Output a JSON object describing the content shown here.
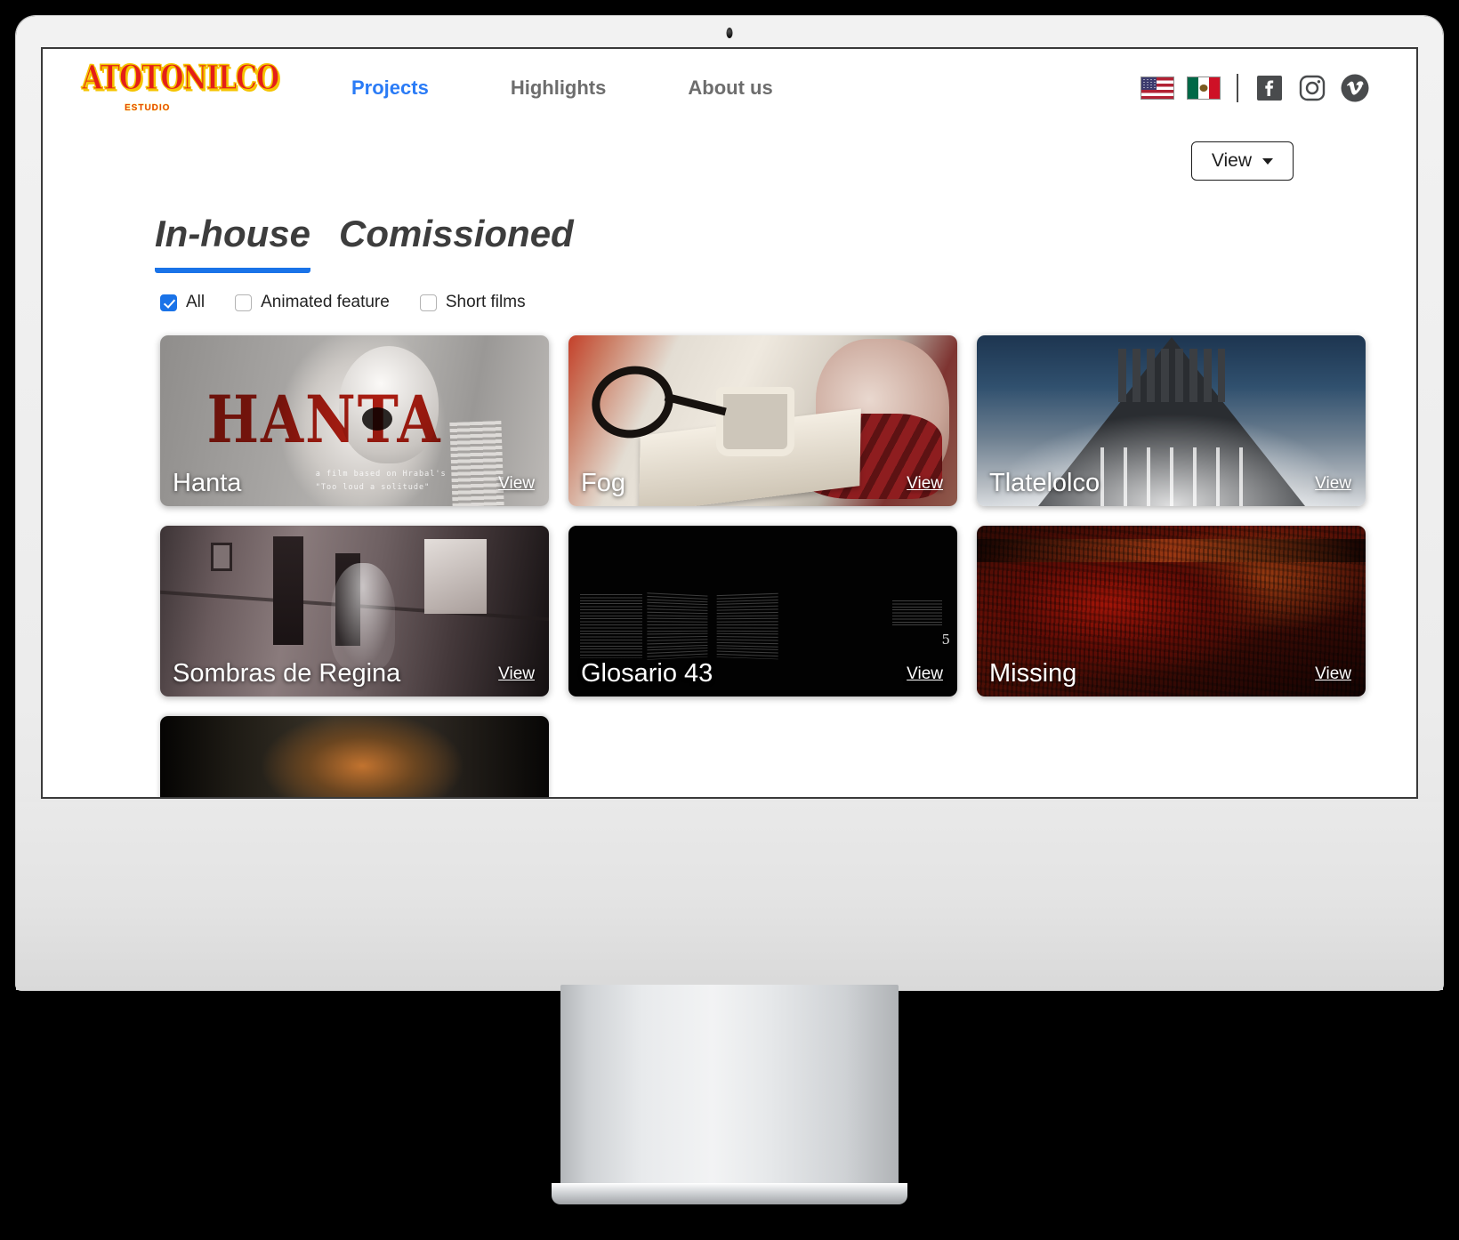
{
  "brand": {
    "logo_text": "ATOTONILCO",
    "logo_sub": "ESTUDIO",
    "accent_red": "#e41f18",
    "accent_yellow": "#f5c400"
  },
  "nav": {
    "items": [
      {
        "label": "Projects",
        "active": true
      },
      {
        "label": "Highlights",
        "active": false
      },
      {
        "label": "About us",
        "active": false
      }
    ],
    "active_color": "#2a7bf6",
    "inactive_color": "#6d6d6d"
  },
  "header_right": {
    "flags": [
      {
        "name": "flag-us-icon",
        "label": "United States"
      },
      {
        "name": "flag-mx-icon",
        "label": "Mexico"
      }
    ],
    "social": [
      {
        "name": "facebook-icon",
        "label": "Facebook"
      },
      {
        "name": "instagram-icon",
        "label": "Instagram"
      },
      {
        "name": "vimeo-icon",
        "label": "Vimeo"
      }
    ]
  },
  "toolbar": {
    "view_label": "View",
    "caret_icon": "chevron-down-icon"
  },
  "tabs": [
    {
      "label": "In-house",
      "active": true
    },
    {
      "label": "Comissioned",
      "active": false
    }
  ],
  "tab_underline_color": "#1a73e8",
  "filters": [
    {
      "label": "All",
      "checked": true
    },
    {
      "label": "Animated feature",
      "checked": false
    },
    {
      "label": "Short films",
      "checked": false
    }
  ],
  "cards": [
    {
      "title": "Hanta",
      "view_label": "View",
      "overlay_word": "HANTA",
      "tagline_line1": "a film based on Hrabal's",
      "tagline_line2": "\"Too loud a solitude\""
    },
    {
      "title": "Fog",
      "view_label": "View"
    },
    {
      "title": "Tlatelolco",
      "view_label": "View"
    },
    {
      "title": "Sombras de Regina",
      "view_label": "View"
    },
    {
      "title": "Glosario 43",
      "view_label": "View",
      "page_number": "5"
    },
    {
      "title": "Missing",
      "view_label": "View"
    }
  ]
}
